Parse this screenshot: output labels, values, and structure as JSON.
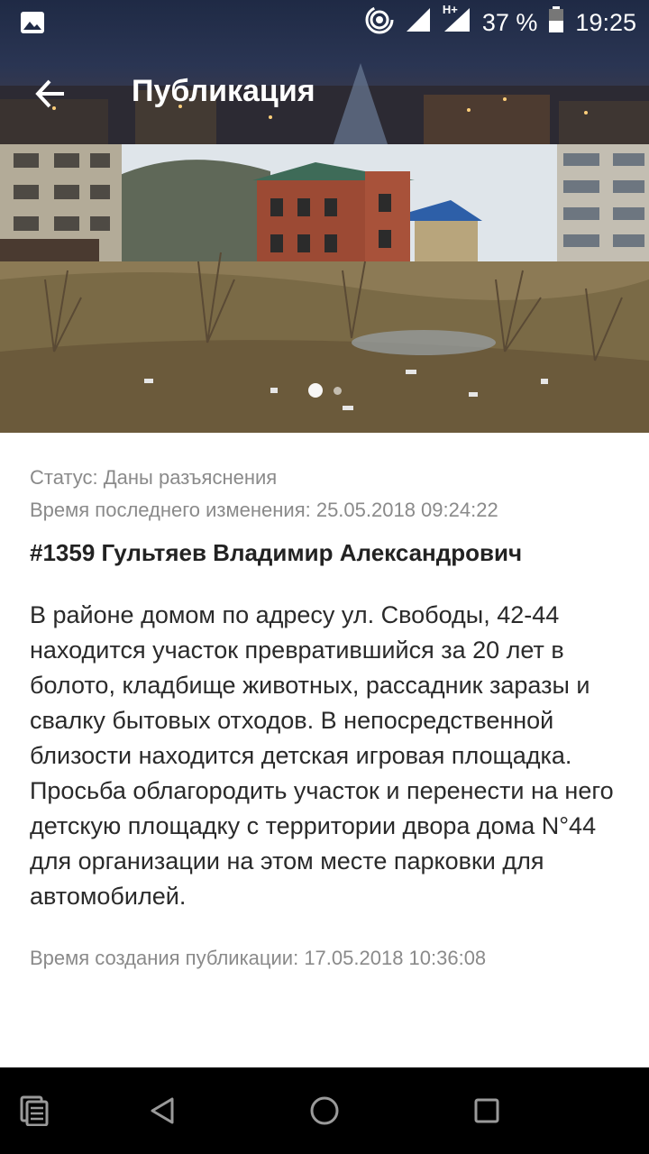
{
  "status_bar": {
    "battery": "37 %",
    "time": "19:25",
    "network": "H+"
  },
  "header": {
    "title": "Публикация"
  },
  "gallery": {
    "slide_count": 2,
    "active_index": 0
  },
  "publication": {
    "status": "Статус: Даны разъяснения",
    "modified": "Время последнего изменения: 25.05.2018 09:24:22",
    "author": "#1359 Гультяев Владимир Александрович",
    "text": "В районе домом по адресу ул. Свободы, 42-44 находится участок превратившийся за 20 лет в болото, кладбище животных, рассадник заразы и свалку бытовых отходов. В непосредственной близости находится детская игровая площадка. Просьба облагородить участок и перенести на него детскую площадку с территории двора дома N°44 для организации на этом месте парковки для автомобилей.",
    "created": "Время создания публикации: 17.05.2018 10:36:08"
  },
  "colors": {
    "header_bg": "#1f2a45",
    "nav_bg": "#000000",
    "meta_text": "#8a8a8a"
  }
}
